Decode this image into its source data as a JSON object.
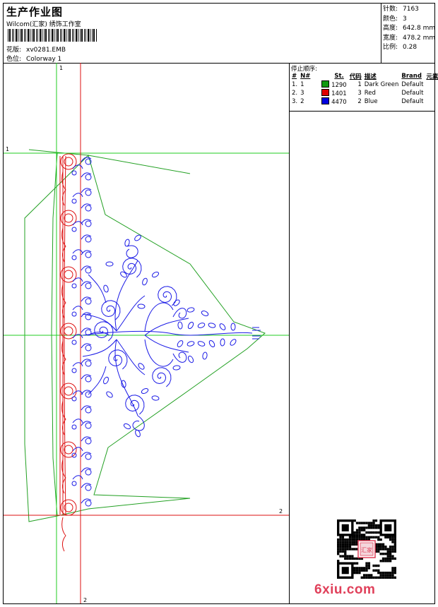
{
  "header": {
    "title": "生产作业图",
    "company": "Wilcom(汇家) 绣饰工作室",
    "design_label": "花版:",
    "design_value": "xv0281.EMB",
    "colorway_label": "色位:",
    "colorway_value": "Colorway 1"
  },
  "stats": [
    {
      "label": "针数:",
      "value": "7163"
    },
    {
      "label": "颜色:",
      "value": "3"
    },
    {
      "label": "高度:",
      "value": "642.8 mm"
    },
    {
      "label": "宽度:",
      "value": "478.2 mm"
    },
    {
      "label": "比例:",
      "value": "0.28"
    }
  ],
  "stop_sequence": {
    "title": "停止顺序:",
    "headers": [
      "#",
      "N#",
      "St.",
      "代码",
      "描述",
      "Brand",
      "元素"
    ],
    "rows": [
      {
        "num": "1.",
        "n": "1",
        "code": "1290",
        "st": "1",
        "desc": "Dark Green",
        "brand": "Default",
        "color": "#119911"
      },
      {
        "num": "2.",
        "n": "3",
        "code": "1401",
        "st": "3",
        "desc": "Red",
        "brand": "Default",
        "color": "#e00000"
      },
      {
        "num": "3.",
        "n": "2",
        "code": "4470",
        "st": "2",
        "desc": "Blue",
        "brand": "Default",
        "color": "#0000e0"
      }
    ]
  },
  "canvas": {
    "guides": [
      {
        "label": "1"
      },
      {
        "label": "1"
      },
      {
        "label": "2"
      },
      {
        "label": "2"
      }
    ],
    "colors": {
      "green": "#22a022",
      "red": "#dd1111",
      "blue": "#1a1ae6"
    }
  },
  "watermark": "6xiu.com",
  "seal_text": "汇家"
}
